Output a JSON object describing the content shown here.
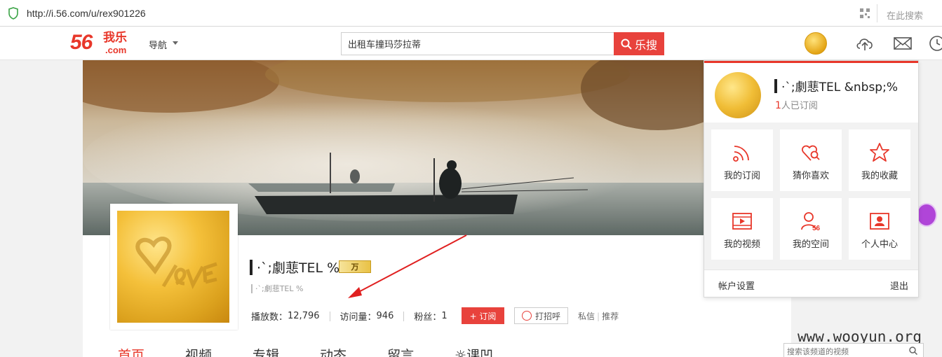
{
  "browser": {
    "url": "http://i.56.com/u/rex901226",
    "search_here": "在此搜索"
  },
  "header": {
    "logo_number": "56",
    "logo_text": "我乐",
    "logo_domain": ".com",
    "nav_label": "导航",
    "search_value": "出租车撞玛莎拉蒂",
    "search_button": "乐搜"
  },
  "profile": {
    "username": "·ˋ;劇蕜TEL %",
    "level_badge": "万",
    "username_small": "·ˋ;劇蕜TEL %",
    "plays_label": "播放数：",
    "plays_value": "12,796",
    "visits_label": "访问量：",
    "visits_value": "946",
    "fans_label": "粉丝：",
    "fans_value": "1",
    "subscribe_button": "+ 订阅",
    "greet_button": "打招呼",
    "private_msg": "私信",
    "recommend": "推荐"
  },
  "tabs": [
    "首页",
    "视频",
    "专辑",
    "动态",
    "留言",
    "☼课凹"
  ],
  "channel_search_placeholder": "搜索该频道的视频",
  "watermark": "www.wooyun.org",
  "dropdown": {
    "name": "·ˋ;劇蕜TEL &nbsp;%",
    "subs_count": "1",
    "subs_text": "人已订阅",
    "items": [
      {
        "label": "我的订阅",
        "icon": "rss-icon"
      },
      {
        "label": "猜你喜欢",
        "icon": "heart-search-icon"
      },
      {
        "label": "我的收藏",
        "icon": "star-icon"
      },
      {
        "label": "我的视频",
        "icon": "video-icon"
      },
      {
        "label": "我的空间",
        "icon": "user-56-icon"
      },
      {
        "label": "个人中心",
        "icon": "id-card-icon"
      }
    ],
    "account_settings": "帐户设置",
    "logout": "退出"
  },
  "colors": {
    "brand": "#e8372a",
    "button": "#e8423c"
  }
}
